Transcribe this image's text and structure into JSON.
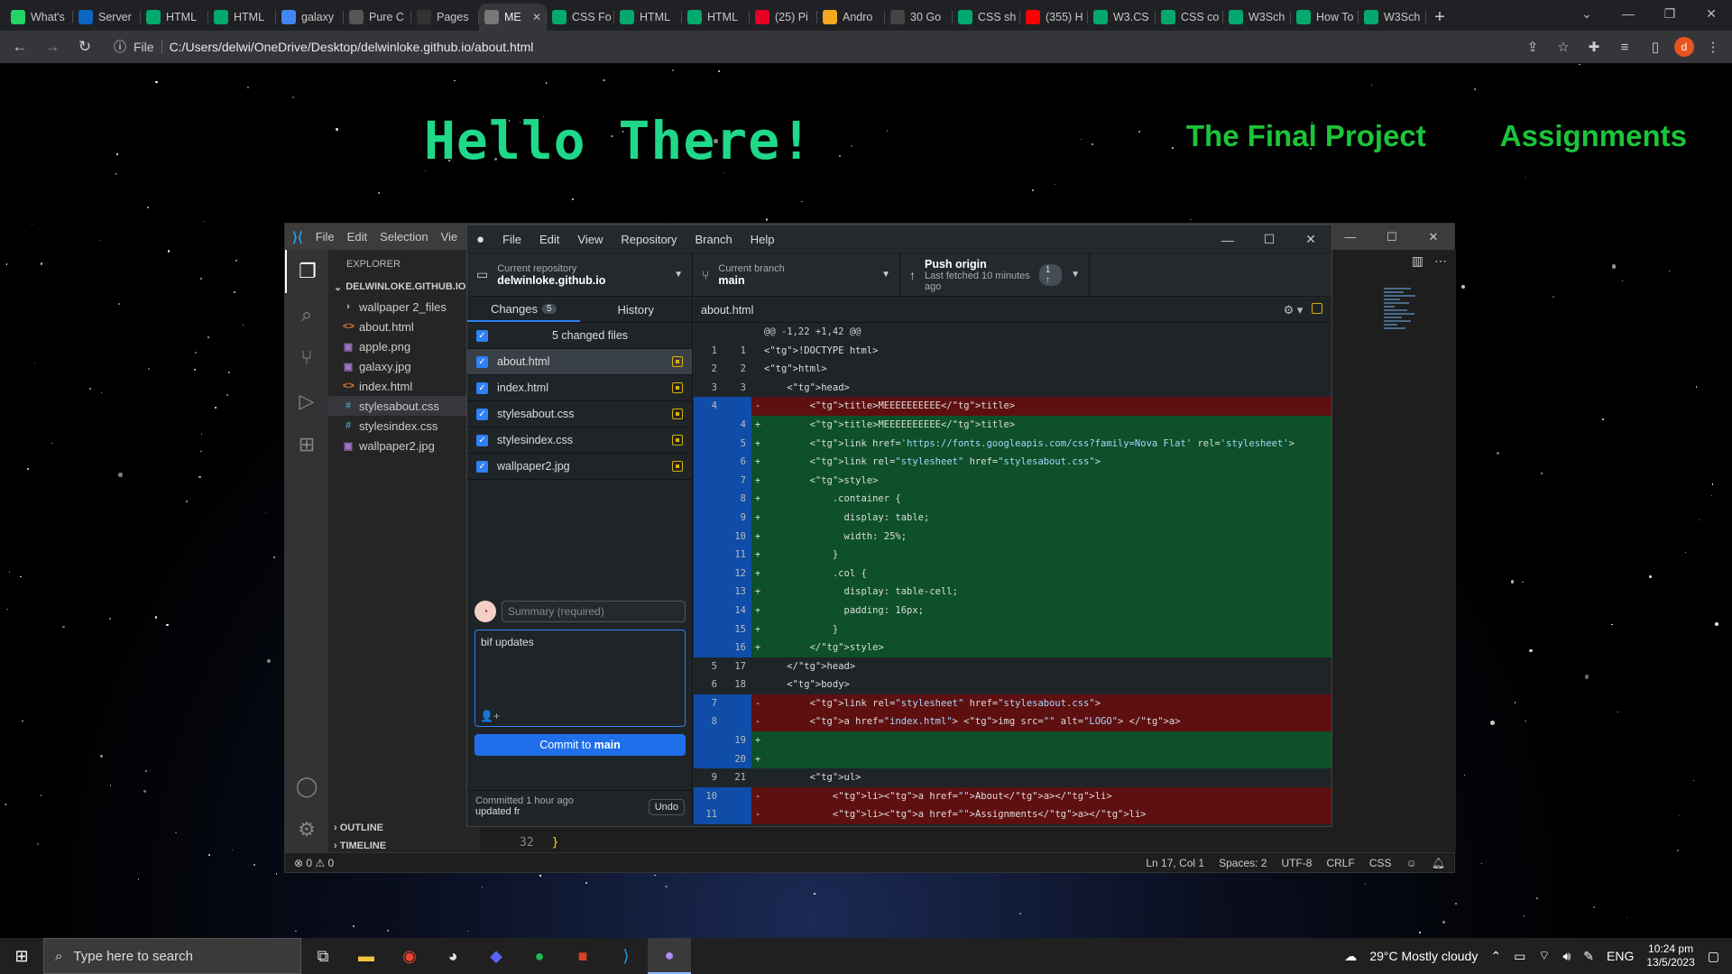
{
  "browser": {
    "tabs": [
      {
        "title": "What's",
        "icon": "whatsapp-icon",
        "color": "#25d366"
      },
      {
        "title": "Server",
        "icon": "azure-icon",
        "color": "#0a66c2"
      },
      {
        "title": "HTML",
        "icon": "w3schools-icon",
        "color": "#04aa6d"
      },
      {
        "title": "HTML",
        "icon": "w3schools-icon",
        "color": "#04aa6d"
      },
      {
        "title": "galaxy",
        "icon": "google-icon",
        "color": "#4285f4"
      },
      {
        "title": "Pure C",
        "icon": "codepen-icon",
        "color": "#555555"
      },
      {
        "title": "Pages",
        "icon": "github-icon",
        "color": "#333333"
      },
      {
        "title": "ME",
        "icon": "globe-icon",
        "color": "#777777",
        "active": true
      },
      {
        "title": "CSS Fo",
        "icon": "w3schools-icon",
        "color": "#04aa6d"
      },
      {
        "title": "HTML",
        "icon": "w3schools-icon",
        "color": "#04aa6d"
      },
      {
        "title": "HTML",
        "icon": "w3schools-icon",
        "color": "#04aa6d"
      },
      {
        "title": "(25) Pi",
        "icon": "pinterest-icon",
        "color": "#e60023"
      },
      {
        "title": "Andro",
        "icon": "wikihow-icon",
        "color": "#f5a623"
      },
      {
        "title": "30 Go",
        "icon": "wikipedia-icon",
        "color": "#444444"
      },
      {
        "title": "CSS sh",
        "icon": "w3schools-icon",
        "color": "#04aa6d"
      },
      {
        "title": "(355) H",
        "icon": "youtube-icon",
        "color": "#ff0000"
      },
      {
        "title": "W3.CS",
        "icon": "w3schools-icon",
        "color": "#04aa6d"
      },
      {
        "title": "CSS co",
        "icon": "w3schools-icon",
        "color": "#04aa6d"
      },
      {
        "title": "W3Sch",
        "icon": "w3schools-icon",
        "color": "#04aa6d"
      },
      {
        "title": "How To",
        "icon": "w3schools-icon",
        "color": "#04aa6d"
      },
      {
        "title": "W3Sch",
        "icon": "w3schools-icon",
        "color": "#04aa6d"
      }
    ],
    "address_label": "File",
    "url": "C:/Users/delwi/OneDrive/Desktop/delwinloke.github.io/about.html",
    "profile_initial": "d"
  },
  "page": {
    "heading": "Hello There!",
    "nav": [
      "The Final Project",
      "Assignments"
    ]
  },
  "vscode": {
    "menu": [
      "File",
      "Edit",
      "Selection",
      "Vie"
    ],
    "explorer_title": "EXPLORER",
    "project": "DELWINLOKE.GITHUB.IO",
    "files": [
      {
        "name": "wallpaper 2_files",
        "type": "folder"
      },
      {
        "name": "about.html",
        "type": "html"
      },
      {
        "name": "apple.png",
        "type": "image"
      },
      {
        "name": "galaxy.jpg",
        "type": "image"
      },
      {
        "name": "index.html",
        "type": "html"
      },
      {
        "name": "stylesabout.css",
        "type": "css",
        "selected": true
      },
      {
        "name": "stylesindex.css",
        "type": "css"
      },
      {
        "name": "wallpaper2.jpg",
        "type": "image"
      }
    ],
    "outline": "OUTLINE",
    "timeline": "TIMELINE",
    "line_no": "32",
    "line_text": "}",
    "status": {
      "problems": "⊗ 0 ⚠ 0",
      "position": "Ln 17, Col 1",
      "spaces": "Spaces: 2",
      "encoding": "UTF-8",
      "eol": "CRLF",
      "language": "CSS"
    }
  },
  "github": {
    "menu": [
      "File",
      "Edit",
      "View",
      "Repository",
      "Branch",
      "Help"
    ],
    "repo_label": "Current repository",
    "repo": "delwinloke.github.io",
    "branch_label": "Current branch",
    "branch": "main",
    "push_label": "Push origin",
    "push_sub": "Last fetched 10 minutes ago",
    "push_badge": "1 ↑",
    "tabs": {
      "changes": "Changes",
      "changes_count": "5",
      "history": "History"
    },
    "changed_files_label": "5 changed files",
    "changed_files": [
      "about.html",
      "index.html",
      "stylesabout.css",
      "stylesindex.css",
      "wallpaper2.jpg"
    ],
    "summary_placeholder": "Summary (required)",
    "description": "bif updates",
    "commit_prefix": "Commit to ",
    "commit_branch": "main",
    "last_commit_time": "Committed 1 hour ago",
    "last_commit_msg": "updated fr",
    "undo": "Undo",
    "diff_file": "about.html",
    "diff": [
      {
        "k": "hunk",
        "a": "",
        "b": "",
        "t": "@@ -1,22 +1,42 @@"
      },
      {
        "k": "ctx",
        "a": "1",
        "b": "1",
        "t": "<!DOCTYPE html>"
      },
      {
        "k": "ctx",
        "a": "2",
        "b": "2",
        "t": "<html>"
      },
      {
        "k": "ctx",
        "a": "3",
        "b": "3",
        "t": "    <head>"
      },
      {
        "k": "del",
        "a": "4",
        "b": "",
        "t": "        <title>MEEEEEEEEEE</title>"
      },
      {
        "k": "add",
        "a": "",
        "b": "4",
        "t": "        <title>MEEEEEEEEEE</title>"
      },
      {
        "k": "add",
        "a": "",
        "b": "5",
        "t": "        <link href='https://fonts.googleapis.com/css?family=Nova Flat' rel='stylesheet'>"
      },
      {
        "k": "add",
        "a": "",
        "b": "6",
        "t": "        <link rel=\"stylesheet\" href=\"stylesabout.css\">"
      },
      {
        "k": "add",
        "a": "",
        "b": "7",
        "t": "        <style>"
      },
      {
        "k": "add",
        "a": "",
        "b": "8",
        "t": "            .container {"
      },
      {
        "k": "add",
        "a": "",
        "b": "9",
        "t": "              display: table;"
      },
      {
        "k": "add",
        "a": "",
        "b": "10",
        "t": "              width: 25%;"
      },
      {
        "k": "add",
        "a": "",
        "b": "11",
        "t": "            }"
      },
      {
        "k": "add",
        "a": "",
        "b": "12",
        "t": "            .col {"
      },
      {
        "k": "add",
        "a": "",
        "b": "13",
        "t": "              display: table-cell;"
      },
      {
        "k": "add",
        "a": "",
        "b": "14",
        "t": "              padding: 16px;"
      },
      {
        "k": "add",
        "a": "",
        "b": "15",
        "t": "            }"
      },
      {
        "k": "add",
        "a": "",
        "b": "16",
        "t": "        </style>"
      },
      {
        "k": "ctx",
        "a": "5",
        "b": "17",
        "t": "    </head>"
      },
      {
        "k": "ctx",
        "a": "6",
        "b": "18",
        "t": "    <body>"
      },
      {
        "k": "del",
        "a": "7",
        "b": "",
        "t": "        <link rel=\"stylesheet\" href=\"stylesabout.css\">"
      },
      {
        "k": "del",
        "a": "8",
        "b": "",
        "t": "        <a href=\"index.html\"> <img src=\"\" alt=\"LOGO\"> </a>"
      },
      {
        "k": "add",
        "a": "",
        "b": "19",
        "t": ""
      },
      {
        "k": "add",
        "a": "",
        "b": "20",
        "t": ""
      },
      {
        "k": "ctx",
        "a": "9",
        "b": "21",
        "t": "        <ul>"
      },
      {
        "k": "del",
        "a": "10",
        "b": "",
        "t": "            <li><a href=\"\">About</a></li>"
      },
      {
        "k": "del",
        "a": "11",
        "b": "",
        "t": "            <li><a href=\"\">Assignments</a></li>"
      }
    ]
  },
  "taskbar": {
    "search_placeholder": "Type here to search",
    "weather": "29°C  Mostly cloudy",
    "lang": "ENG",
    "time": "10:24 pm",
    "date": "13/5/2023"
  }
}
